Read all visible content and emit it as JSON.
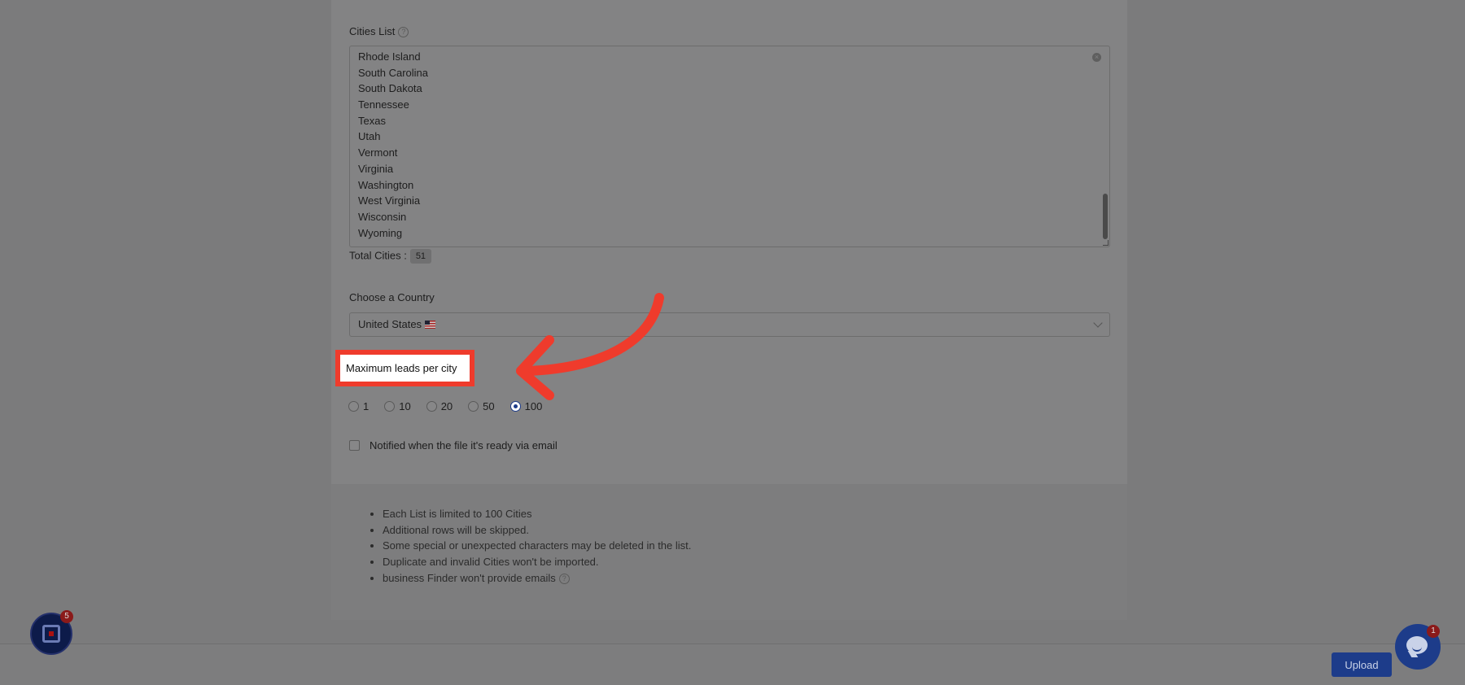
{
  "cities": {
    "label": "Cities List",
    "help_icon": "?",
    "items": [
      "Rhode Island",
      "South Carolina",
      "South Dakota",
      "Tennessee",
      "Texas",
      "Utah",
      "Vermont",
      "Virginia",
      "Washington",
      "West Virginia",
      "Wisconsin",
      "Wyoming"
    ],
    "total_label": "Total Cities :",
    "total_value": "51"
  },
  "country": {
    "label": "Choose a Country",
    "selected": "United States",
    "flag_icon": "us-flag-icon"
  },
  "leads": {
    "label": "Maximum leads per city",
    "options": [
      "1",
      "10",
      "20",
      "50",
      "100"
    ],
    "selected": "100"
  },
  "notify": {
    "label": "Notified when the file it's ready via email",
    "checked": false
  },
  "notes": [
    "Each List is limited to 100 Cities",
    "Additional rows will be skipped.",
    "Some special or unexpected characters may be deleted in the list.",
    "Duplicate and invalid Cities won't be imported.",
    "business Finder won't provide emails"
  ],
  "upload": {
    "label": "Upload"
  },
  "launcher": {
    "badge": "5"
  },
  "chat": {
    "badge": "1"
  },
  "colors": {
    "accent": "#1d3c8a",
    "highlight": "#ef3b2c"
  }
}
